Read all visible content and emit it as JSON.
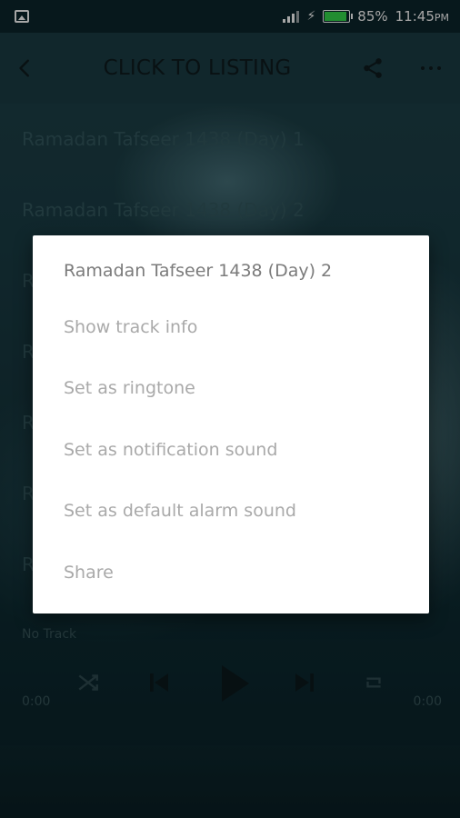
{
  "status_bar": {
    "battery": "85%",
    "time": "11:45",
    "time_suffix": "PM"
  },
  "toolbar": {
    "title": "CLICK TO LISTING"
  },
  "list": {
    "items": [
      "Ramadan Tafseer 1438 (Day) 1",
      "Ramadan Tafseer 1438 (Day) 2",
      "R",
      "R",
      "R",
      "R",
      "R"
    ]
  },
  "player": {
    "now_playing": "No Track",
    "time_elapsed": "0:00",
    "time_total": "0:00"
  },
  "dialog": {
    "title": "Ramadan Tafseer 1438 (Day) 2",
    "options": [
      "Show track info",
      "Set as ringtone",
      "Set as notification sound",
      "Set as default alarm sound",
      "Share"
    ]
  },
  "colors": {
    "toolbar_bg": "#1b3d44",
    "status_bg": "#0c252b",
    "battery_fill": "#35d94c",
    "dialog_bg": "#ffffff"
  },
  "icons": {
    "status_left": "gallery-icon",
    "toolbar_left": "back-arrow-icon",
    "toolbar_right": [
      "share-icon",
      "more-icon"
    ],
    "player_controls": [
      "shuffle-icon",
      "skip-previous-icon",
      "play-icon",
      "skip-next-icon",
      "repeat-icon"
    ]
  }
}
